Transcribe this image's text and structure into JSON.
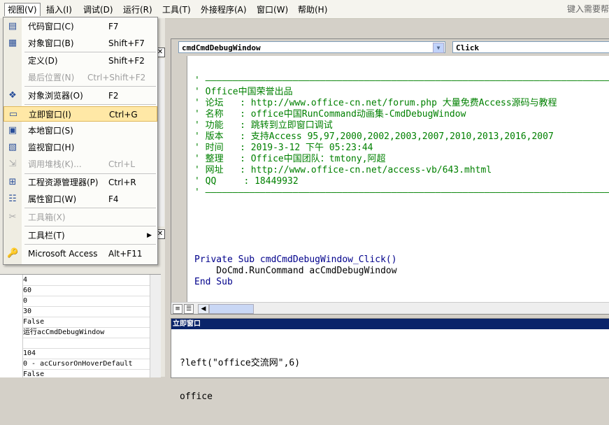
{
  "menubar": {
    "items": [
      "视图(V)",
      "插入(I)",
      "调试(D)",
      "运行(R)",
      "工具(T)",
      "外接程序(A)",
      "窗口(W)",
      "帮助(H)"
    ],
    "help_placeholder": "键入需要帮"
  },
  "view_menu": {
    "items": [
      {
        "label": "代码窗口(C)",
        "shortcut": "F7",
        "icon": "code-window-icon",
        "enabled": true
      },
      {
        "label": "对象窗口(B)",
        "shortcut": "Shift+F7",
        "icon": "object-window-icon",
        "enabled": true
      },
      {
        "label": "定义(D)",
        "shortcut": "Shift+F2",
        "icon": "",
        "enabled": true
      },
      {
        "label": "最后位置(N)",
        "shortcut": "Ctrl+Shift+F2",
        "icon": "",
        "enabled": false
      },
      {
        "label": "对象浏览器(O)",
        "shortcut": "F2",
        "icon": "object-browser-icon",
        "enabled": true
      },
      {
        "label": "立即窗口(I)",
        "shortcut": "Ctrl+G",
        "icon": "immediate-window-icon",
        "enabled": true,
        "highlighted": true
      },
      {
        "label": "本地窗口(S)",
        "shortcut": "",
        "icon": "locals-window-icon",
        "enabled": true
      },
      {
        "label": "监视窗口(H)",
        "shortcut": "",
        "icon": "watch-window-icon",
        "enabled": true
      },
      {
        "label": "调用堆栈(K)...",
        "shortcut": "Ctrl+L",
        "icon": "call-stack-icon",
        "enabled": false
      },
      {
        "label": "工程资源管理器(P)",
        "shortcut": "Ctrl+R",
        "icon": "project-explorer-icon",
        "enabled": true
      },
      {
        "label": "属性窗口(W)",
        "shortcut": "F4",
        "icon": "properties-window-icon",
        "enabled": true
      },
      {
        "label": "工具箱(X)",
        "shortcut": "",
        "icon": "toolbox-icon",
        "enabled": false
      },
      {
        "label": "工具栏(T)",
        "shortcut": "",
        "icon": "",
        "enabled": true,
        "submenu": true
      },
      {
        "label": "Microsoft Access",
        "shortcut": "Alt+F11",
        "icon": "access-icon",
        "enabled": true
      }
    ]
  },
  "code_window": {
    "object_combo": "cmdCmdDebugWindow",
    "proc_combo": "Click",
    "lines": [
      {
        "text": "' ——————————————————————————————————————————————————————————————————————————————",
        "kind": "comment"
      },
      {
        "text": "' Office中国荣誉出品",
        "kind": "comment"
      },
      {
        "text": "' 论坛   : http://www.office-cn.net/forum.php 大量免费Access源码与教程",
        "kind": "comment"
      },
      {
        "text": "' 名称   : office中国RunCommand动画集-CmdDebugWindow",
        "kind": "comment"
      },
      {
        "text": "' 功能   : 跳转到立即窗口调试",
        "kind": "comment"
      },
      {
        "text": "' 版本   : 支持Access 95,97,2000,2002,2003,2007,2010,2013,2016,2007",
        "kind": "comment"
      },
      {
        "text": "' 时间   : 2019-3-12 下午 05:23:44",
        "kind": "comment"
      },
      {
        "text": "' 整理   : Office中国团队：tmtony,阿超",
        "kind": "comment"
      },
      {
        "text": "' 网址   : http://www.office-cn.net/access-vb/643.mhtml",
        "kind": "comment"
      },
      {
        "text": "' QQ     : 18449932",
        "kind": "comment"
      },
      {
        "text": "' ——————————————————————————————————————————————————————————————————————————————",
        "kind": "comment"
      },
      {
        "text": "",
        "kind": "plain"
      },
      {
        "text": "",
        "kind": "plain"
      },
      {
        "text": "",
        "kind": "plain"
      },
      {
        "text": "",
        "kind": "plain"
      },
      {
        "text": "",
        "kind": "plain"
      },
      {
        "text": "Private Sub cmdCmdDebugWindow_Click()",
        "kind": "keyword"
      },
      {
        "text": "    DoCmd.RunCommand acCmdDebugWindow",
        "kind": "plain"
      },
      {
        "text": "End Sub",
        "kind": "keyword"
      }
    ]
  },
  "immediate_window": {
    "title": "立即窗口",
    "lines": [
      "?left(\"office交流网\",6)",
      "office"
    ]
  },
  "properties": {
    "values": [
      "4",
      "60",
      "0",
      "30",
      "False",
      "运行acCmdDebugWindow",
      "",
      "104",
      "0 - acCursorOnHoverDefault",
      "False"
    ]
  }
}
